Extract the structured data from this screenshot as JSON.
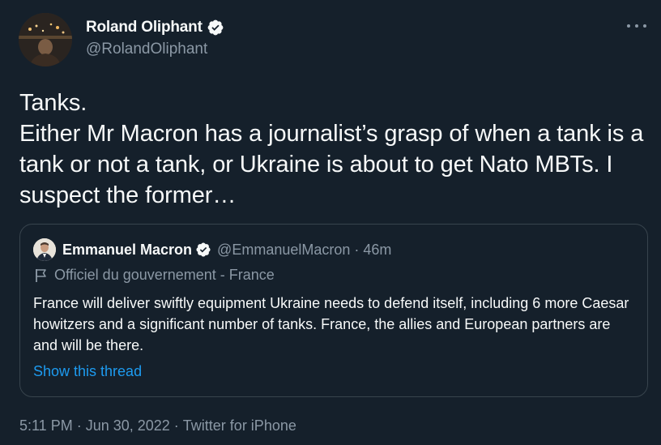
{
  "author": {
    "name": "Roland Oliphant",
    "handle": "@RolandOliphant",
    "verified": true
  },
  "tweet": {
    "text": "Tanks.\nEither Mr Macron has a journalist’s grasp of when a tank is a tank or not a tank, or Ukraine is about to get Nato MBTs. I suspect the former…"
  },
  "quote": {
    "name": "Emmanuel Macron",
    "handle": "@EmmanuelMacron",
    "separator": "·",
    "time": "46m",
    "label": "Officiel du gouvernement - France",
    "text": "France will deliver swiftly equipment Ukraine needs to defend itself, including 6 more Caesar howitzers and a significant number of tanks. France, the allies and European partners are and will be there.",
    "thread_link": "Show this thread"
  },
  "meta": {
    "time": "5:11 PM",
    "dot1": "·",
    "date": "Jun 30, 2022",
    "dot2": "·",
    "source": "Twitter for iPhone"
  },
  "colors": {
    "background": "#15202b",
    "text": "#f7f9f9",
    "secondary": "#8b98a5",
    "accent": "#1d9bf0",
    "border": "#38444d"
  },
  "icons": [
    "verified-badge-icon",
    "more-options-icon",
    "government-flag-icon"
  ]
}
